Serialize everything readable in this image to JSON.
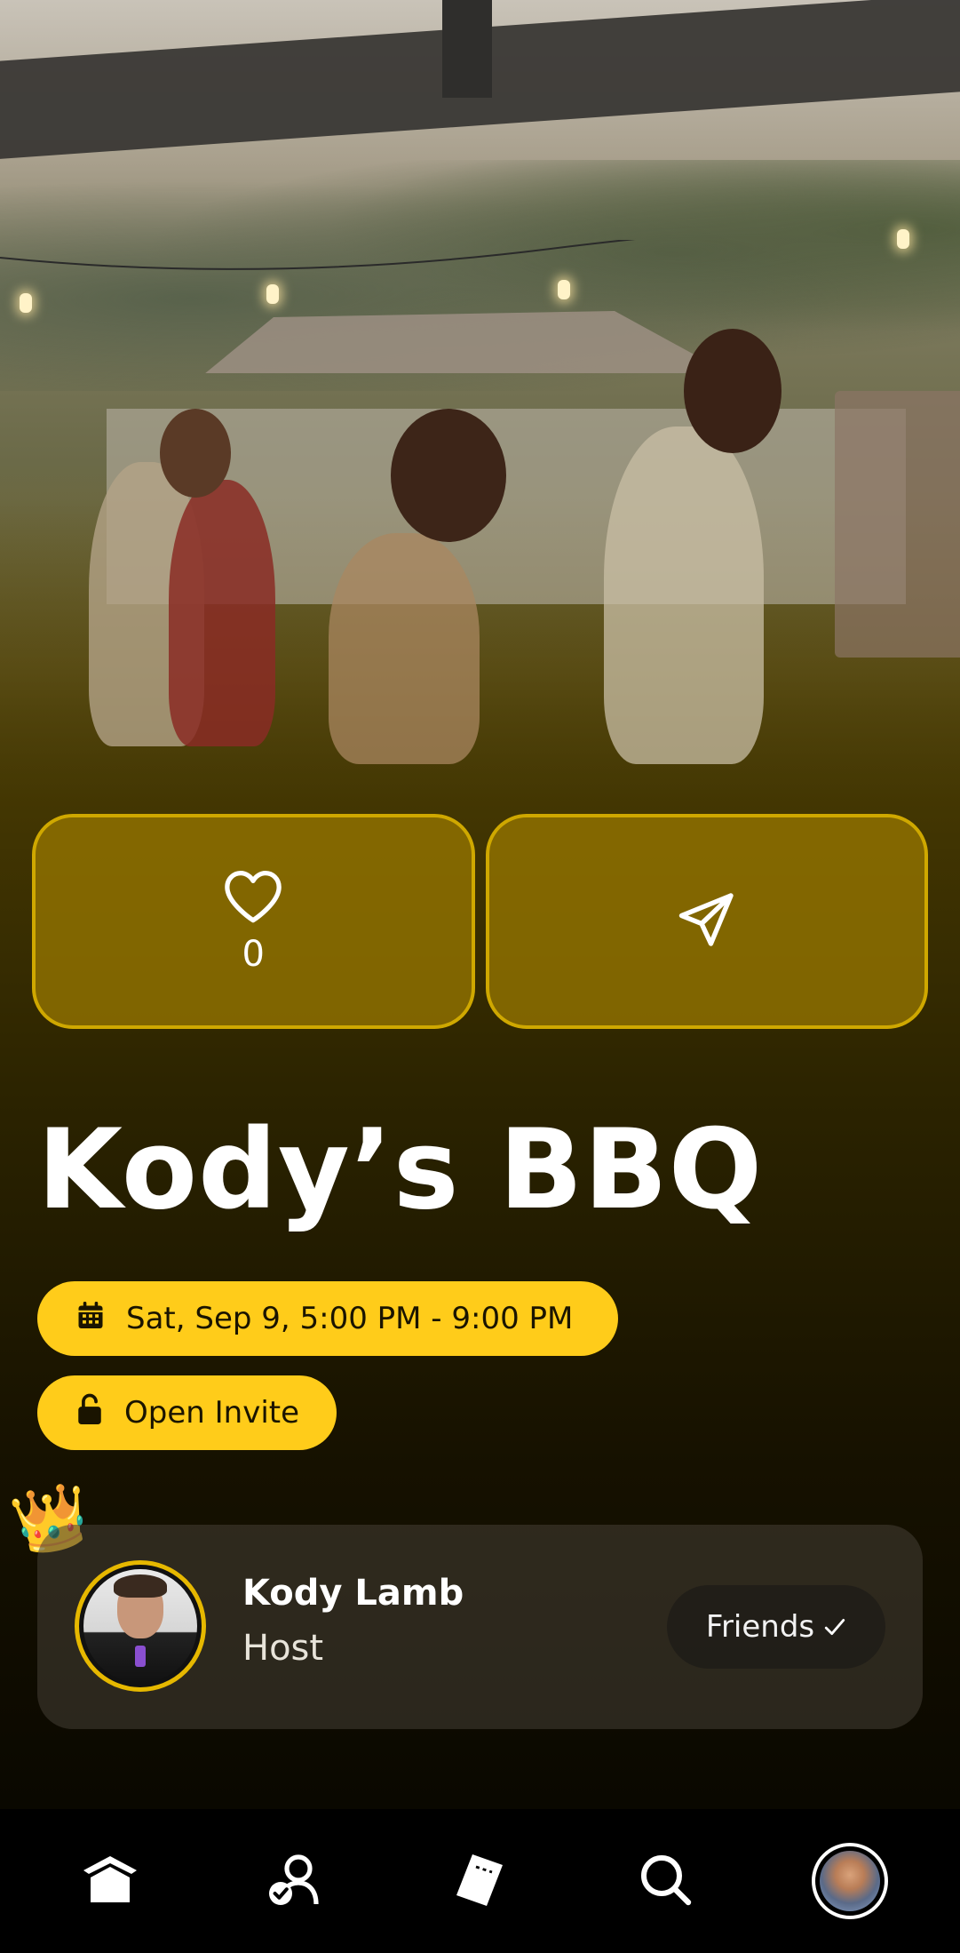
{
  "event": {
    "title": "Kody’s BBQ",
    "like_count": "0",
    "date_time": "Sat, Sep 9, 5:00 PM - 9:00 PM",
    "privacy": "Open Invite"
  },
  "host": {
    "name": "Kody Lamb",
    "role": "Host",
    "relationship": "Friends",
    "badge_icon": "crown-icon"
  },
  "icons": {
    "like": "heart-icon",
    "share": "send-icon",
    "date": "calendar-icon",
    "privacy": "unlock-icon",
    "relationship": "check-icon"
  },
  "tabbar": {
    "items": [
      "home-icon",
      "friends-icon",
      "ticket-icon",
      "search-icon",
      "profile-avatar"
    ]
  },
  "colors": {
    "accent": "#ffcc1a",
    "card_border": "#cfa800",
    "background": "#000000"
  }
}
